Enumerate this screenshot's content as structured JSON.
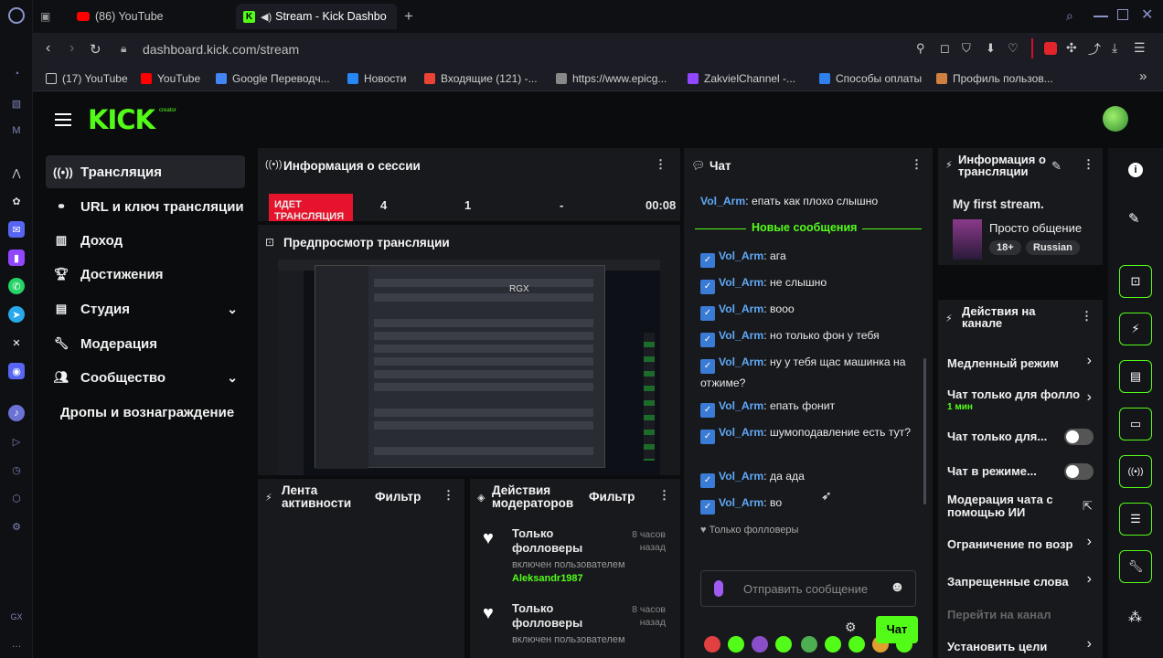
{
  "browser": {
    "tabs": [
      {
        "label": "(86) YouTube"
      },
      {
        "label": "Stream - Kick Dashbo"
      }
    ],
    "url": "dashboard.kick.com/stream",
    "bookmarks": [
      {
        "label": "(17) YouTube",
        "color": "#e0e0e0"
      },
      {
        "label": "YouTube",
        "color": "#ff0000"
      },
      {
        "label": "Google Переводч...",
        "color": "#4285f4"
      },
      {
        "label": "Новости",
        "color": "#2787f5"
      },
      {
        "label": "Входящие (121) -...",
        "color": "#ea4335"
      },
      {
        "label": "https://www.epicg...",
        "color": "#888888"
      },
      {
        "label": "ZakvielChannel -...",
        "color": "#9146ff"
      },
      {
        "label": "Способы оплаты",
        "color": "#2f80ed"
      },
      {
        "label": "Профиль пользов...",
        "color": "#d08040"
      }
    ]
  },
  "app": {
    "logo": "KICK",
    "logo_sup": "creator",
    "accent": "#53fc18"
  },
  "sidebar": {
    "items": [
      {
        "label": "Трансляция",
        "icon": "broadcast-icon"
      },
      {
        "label": "URL и ключ трансляции",
        "icon": "link-icon"
      },
      {
        "label": "Доход",
        "icon": "chart-icon"
      },
      {
        "label": "Достижения",
        "icon": "trophy-icon"
      },
      {
        "label": "Студия",
        "icon": "studio-icon"
      },
      {
        "label": "Модерация",
        "icon": "wrench-icon"
      },
      {
        "label": "Сообщество",
        "icon": "people-icon"
      },
      {
        "label": "Дропы и вознаграждение",
        "icon": ""
      }
    ]
  },
  "session": {
    "title": "Информация о сессии",
    "live_badge": "ИДЕТ ТРАНСЛЯЦИЯ",
    "stats": [
      "4",
      "1",
      "-",
      "00:08"
    ]
  },
  "preview": {
    "title": "Предпросмотр трансляции",
    "overlay_text": "RGX"
  },
  "activity": {
    "title": "Лента активности",
    "filter": "Фильтр"
  },
  "modactions": {
    "title": "Действия модераторов",
    "filter": "Фильтр",
    "entries": [
      {
        "title": "Только фолловеры",
        "time": "8 часов назад",
        "sub": "включен пользователем",
        "user": "Aleksandr1987"
      },
      {
        "title": "Только фолловеры",
        "time": "8 часов назад",
        "sub": "включен пользователем",
        "user": ""
      }
    ]
  },
  "chat": {
    "title": "Чат",
    "top_message": {
      "user": "Vol_Arm",
      "text": ": епать как плохо слышно"
    },
    "new_messages": "Новые сообщения",
    "messages": [
      {
        "user": "Vol_Arm",
        "text": ": ага"
      },
      {
        "user": "Vol_Arm",
        "text": ": не слышно"
      },
      {
        "user": "Vol_Arm",
        "text": ": вооо"
      },
      {
        "user": "Vol_Arm",
        "text": ": но только фон у тебя"
      },
      {
        "user": "Vol_Arm",
        "text": ": ну у тебя щас машинка на отжиме?"
      },
      {
        "user": "Vol_Arm",
        "text": ": епать фонит"
      },
      {
        "user": "Vol_Arm",
        "text": ": шумоподавление есть тут?"
      },
      {
        "user": "Vol_Arm",
        "text": ": да ада"
      },
      {
        "user": "Vol_Arm",
        "text": ": во"
      }
    ],
    "followers_only": "Только фолловеры",
    "input_placeholder": "Отправить сообщение",
    "send": "Чат"
  },
  "streaminfo": {
    "title": "Информация о трансляции",
    "stream_title": "My first stream.",
    "category": "Просто общение",
    "tags": [
      "18+",
      "Russian"
    ]
  },
  "channel_actions": {
    "title": "Действия на канале",
    "items": [
      {
        "label": "Медленный режим",
        "control": "chevron"
      },
      {
        "label": "Чат только для фолло",
        "sub": "1 мин",
        "control": "chevron"
      },
      {
        "label": "Чат только для...",
        "control": "toggle"
      },
      {
        "label": "Чат в режиме...",
        "control": "toggle"
      },
      {
        "label": "Модерация чата с помощью ИИ",
        "control": "external"
      },
      {
        "label": "Ограничение по возр",
        "control": "chevron"
      },
      {
        "label": "Запрещенные слова",
        "control": "chevron"
      },
      {
        "label": "Перейти на канал",
        "control": "none"
      },
      {
        "label": "Установить цели",
        "control": "chevron"
      }
    ]
  }
}
